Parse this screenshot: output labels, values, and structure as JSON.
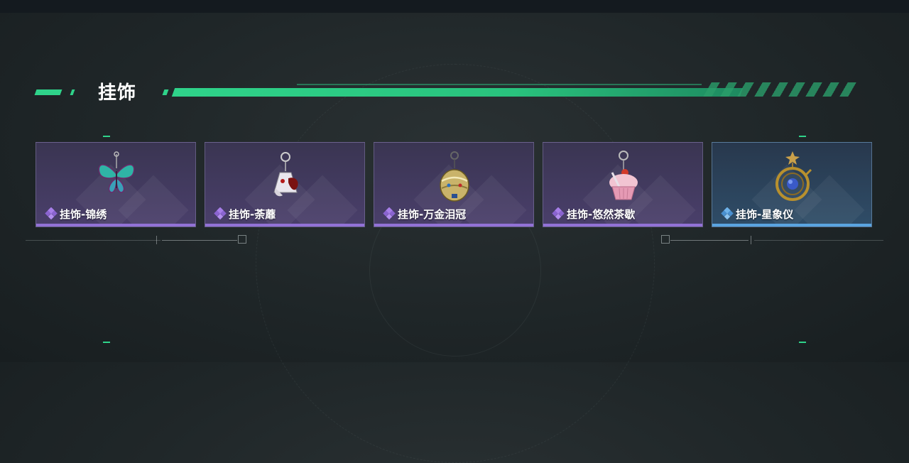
{
  "section": {
    "title": "挂饰"
  },
  "colors": {
    "accent_green": "#2fd38a",
    "rarity_purple": "#9272d6",
    "rarity_blue": "#5aa4e0"
  },
  "items": [
    {
      "name": "挂饰-锦绣",
      "rarity": "purple",
      "icon": "butterfly-charm-icon"
    },
    {
      "name": "挂饰-荼蘼",
      "rarity": "purple",
      "icon": "flower-dress-charm-icon"
    },
    {
      "name": "挂饰-万金泪冠",
      "rarity": "purple",
      "icon": "jeweled-crown-charm-icon"
    },
    {
      "name": "挂饰-悠然茶歇",
      "rarity": "purple",
      "icon": "cupcake-charm-icon"
    },
    {
      "name": "挂饰-星象仪",
      "rarity": "blue",
      "icon": "armillary-charm-icon"
    }
  ]
}
